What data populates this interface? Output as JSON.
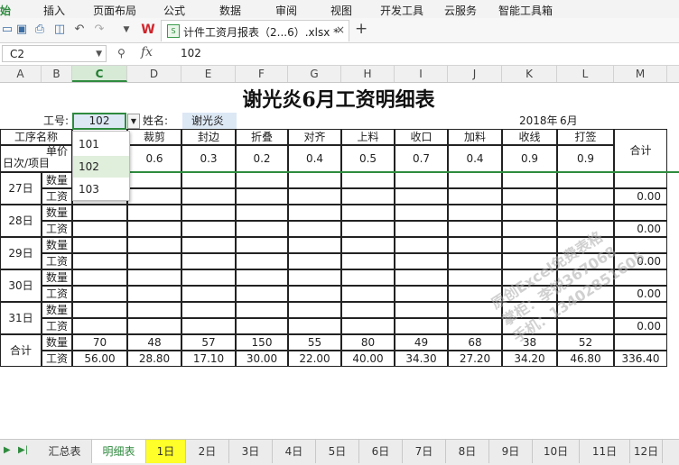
{
  "menu": {
    "items": [
      "始",
      "插入",
      "页面布局",
      "公式",
      "数据",
      "审阅",
      "视图",
      "开发工具",
      "云服务",
      "智能工具箱"
    ]
  },
  "doc_tab": {
    "title": "计件工资月报表（2...6）.xlsx *",
    "close": "×"
  },
  "formula": {
    "cell_ref": "C2",
    "fx_label": "fx",
    "value": "102"
  },
  "columns": [
    "A",
    "B",
    "C",
    "D",
    "E",
    "F",
    "G",
    "H",
    "I",
    "J",
    "K",
    "L",
    "M"
  ],
  "sheet": {
    "title": "谢光炎6月工资明细表",
    "id_label": "工号:",
    "id_value": "102",
    "name_label": "姓名:",
    "name_value": "谢光炎",
    "year": "2018年",
    "month": "6月",
    "process_label": "工序名称",
    "unit_price_label": "单价",
    "date_item_label": "日次/项目",
    "total_label": "合计",
    "qty_label": "数量",
    "wage_label": "工资",
    "processes": [
      "裁剪",
      "封边",
      "折叠",
      "对齐",
      "上料",
      "收口",
      "加料",
      "收线",
      "打签"
    ],
    "prices": [
      "0.6",
      "0.3",
      "0.2",
      "0.4",
      "0.5",
      "0.7",
      "0.4",
      "0.9",
      "0.9"
    ],
    "days": [
      "27日",
      "28日",
      "29日",
      "30日",
      "31日"
    ],
    "day_totals": [
      "0.00",
      "0.00",
      "0.00",
      "0.00",
      "0.00"
    ],
    "total_qty": [
      "70",
      "48",
      "57",
      "150",
      "55",
      "80",
      "49",
      "68",
      "38",
      "52"
    ],
    "total_wage": [
      "56.00",
      "28.80",
      "17.10",
      "30.00",
      "22.00",
      "40.00",
      "34.30",
      "27.20",
      "34.20",
      "46.80",
      "336.40"
    ]
  },
  "dropdown": {
    "options": [
      "101",
      "102",
      "103"
    ],
    "selected": "102"
  },
  "sheet_tabs": [
    "汇总表",
    "明细表",
    "1日",
    "2日",
    "3日",
    "4日",
    "5日",
    "6日",
    "7日",
    "8日",
    "9日",
    "10日",
    "11日",
    "12日"
  ],
  "active_tab": "明细表",
  "watermark": [
    "原创Excel免费表格",
    "掌柜：李锐367068",
    "手机：13402851605"
  ]
}
